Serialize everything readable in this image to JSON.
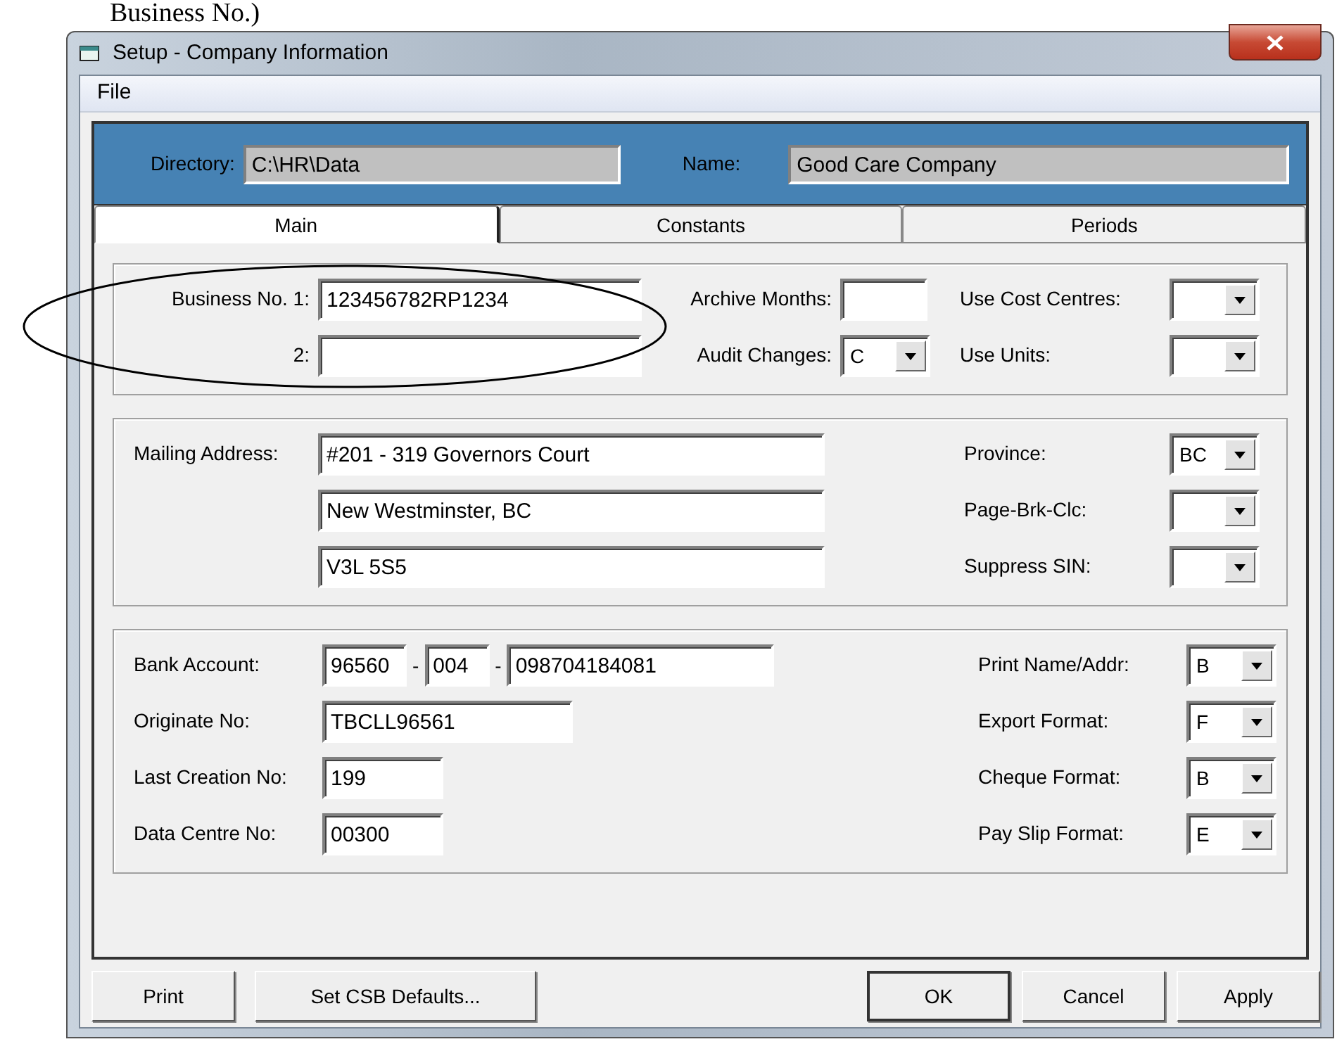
{
  "page_caption": "Business No.)",
  "window": {
    "title": "Setup - Company Information"
  },
  "menu": [
    {
      "label": "File"
    }
  ],
  "header": {
    "directory_label": "Directory:",
    "directory": "C:\\HR\\Data",
    "name_label": "Name:",
    "name": "Good Care Company"
  },
  "tabs": [
    {
      "label": "Main",
      "selected": true
    },
    {
      "label": "Constants",
      "selected": false
    },
    {
      "label": "Periods",
      "selected": false
    }
  ],
  "sections": [
    {
      "columns": [
        [
          {
            "kind": "text",
            "label": "Business No. 1:",
            "value": "123456782RP1234"
          },
          {
            "kind": "text",
            "label": "2:"
          }
        ],
        [
          {
            "kind": "text",
            "label": "Archive Months:"
          },
          {
            "kind": "combo",
            "label": "Audit Changes:",
            "value": "C"
          }
        ],
        [
          {
            "kind": "combo",
            "label": "Use Cost Centres:"
          },
          {
            "kind": "combo",
            "label": "Use Units:"
          }
        ]
      ]
    },
    {
      "columns": [
        [
          {
            "kind": "text",
            "label": "Mailing Address:",
            "value": "#201 - 319 Governors Court"
          },
          {
            "kind": "text",
            "value": "New Westminster, BC"
          },
          {
            "kind": "text",
            "value": "V3L 5S5"
          }
        ],
        [
          {
            "kind": "combo",
            "label": "Province:",
            "value": "BC"
          },
          {
            "kind": "combo",
            "label": "Page-Brk-Clc:"
          },
          {
            "kind": "combo",
            "label": "Suppress SIN:"
          }
        ]
      ]
    },
    {
      "columns": [
        [
          {
            "kind": "split",
            "label": "Bank Account:",
            "parts": [
              "96560",
              "004",
              "098704184081"
            ],
            "separators": [
              "-",
              "-"
            ]
          },
          {
            "kind": "text",
            "label": "Originate No:",
            "value": "TBCLL96561"
          },
          {
            "kind": "text",
            "label": "Last Creation No:",
            "value": "199"
          },
          {
            "kind": "text",
            "label": "Data Centre No:",
            "value": "00300"
          }
        ],
        [
          {
            "kind": "combo",
            "label": "Print Name/Addr:",
            "value": "B"
          },
          {
            "kind": "combo",
            "label": "Export Format:",
            "value": "F"
          },
          {
            "kind": "combo",
            "label": "Cheque Format:",
            "value": "B"
          },
          {
            "kind": "combo",
            "label": "Pay Slip Format:",
            "value": "E"
          }
        ]
      ]
    }
  ],
  "buttons_left": [
    {
      "label": "Print",
      "default": false
    },
    {
      "label": "Set CSB Defaults...",
      "default": false
    }
  ],
  "buttons_right": [
    {
      "label": "OK",
      "default": true
    },
    {
      "label": "Cancel",
      "default": false
    },
    {
      "label": "Apply",
      "default": false
    }
  ]
}
